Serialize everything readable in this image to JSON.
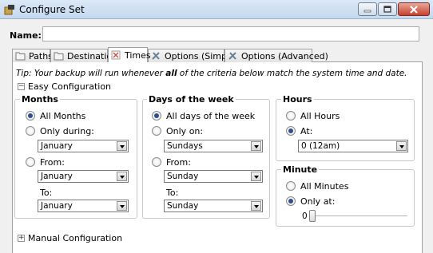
{
  "window": {
    "title": "Configure Set"
  },
  "name_field": {
    "label": "Name:",
    "value": ""
  },
  "tabs": [
    {
      "label": "Paths",
      "icon": "folder-icon"
    },
    {
      "label": "Destination",
      "icon": "folder-icon"
    },
    {
      "label": "Times",
      "icon": "clock-icon",
      "active": true
    },
    {
      "label": "Options (Simple)",
      "icon": "tools-icon"
    },
    {
      "label": "Options (Advanced)",
      "icon": "tools-icon"
    }
  ],
  "tip": {
    "prefix": "Tip: Your backup will run whenever ",
    "bold": "all",
    "suffix": " of the criteria below match the system time and date."
  },
  "easy_config": {
    "label": "Easy Configuration",
    "expanded": true
  },
  "manual_config": {
    "label": "Manual Configuration",
    "expanded": false
  },
  "months": {
    "title": "Months",
    "all_label": "All Months",
    "only_label": "Only during:",
    "only_value": "January",
    "from_label": "From:",
    "from_value": "January",
    "to_label": "To:",
    "to_value": "January",
    "selected": "all"
  },
  "days": {
    "title": "Days of the week",
    "all_label": "All days of the week",
    "only_label": "Only on:",
    "only_value": "Sundays",
    "from_label": "From:",
    "from_value": "Sunday",
    "to_label": "To:",
    "to_value": "Sunday",
    "selected": "all"
  },
  "hours": {
    "title": "Hours",
    "all_label": "All Hours",
    "at_label": "At:",
    "at_value": "0 (12am)",
    "selected": "at"
  },
  "minute": {
    "title": "Minute",
    "all_label": "All Minutes",
    "only_label": "Only at:",
    "slider_value": "0",
    "selected": "only"
  }
}
